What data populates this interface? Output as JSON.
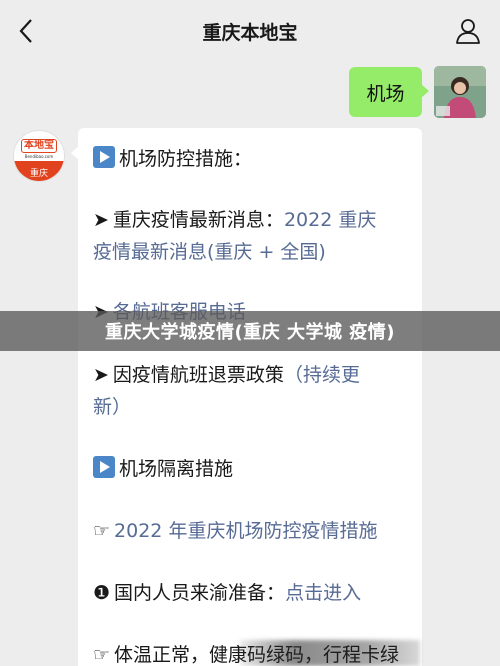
{
  "navbar": {
    "title": "重庆本地宝",
    "back_icon": "chevron-left-icon",
    "profile_icon": "user-icon"
  },
  "user_message": {
    "text": "机场"
  },
  "bot_avatar": {
    "logo": "本地宝",
    "site": "Bendibao.com",
    "city": "重庆"
  },
  "bot_message": {
    "section1_title": "机场防控措施：",
    "item1_prefix": "重庆疫情最新消息：",
    "item1_link_line1": "2022 重庆",
    "item1_link_line2": "疫情最新消息(重庆 + 全国)",
    "item2_text": "各航班客服电话",
    "item3_line1_prefix": "因疫情航班退票政策",
    "item3_line1_link": "（持续更",
    "item3_line2_link": "新）",
    "section2_title": "机场隔离措施",
    "item4_link": "2022 年重庆机场防控疫情措施",
    "item5_prefix": "国内人员来渝准备：",
    "item5_link": "点击进入",
    "item6_text": "体温正常，健康码绿码，行程卡绿"
  },
  "overlay": {
    "caption": "重庆大学城疫情(重庆 大学城 疫情)"
  },
  "colors": {
    "background": "#ededed",
    "user_bubble": "#95ec69",
    "link": "#576b95",
    "brand_red": "#e2431f"
  }
}
